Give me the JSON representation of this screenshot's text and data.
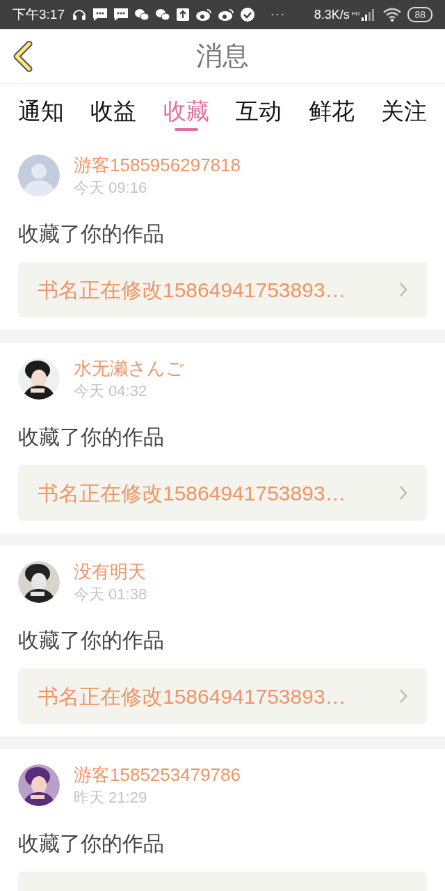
{
  "status_bar": {
    "time": "下午3:17",
    "more": "···",
    "speed": "8.3K/s",
    "network": "HD",
    "battery": "88"
  },
  "header": {
    "back": true,
    "title": "消息"
  },
  "tabs": [
    {
      "label": "通知",
      "selected": false
    },
    {
      "label": "收益",
      "selected": false
    },
    {
      "label": "收藏",
      "selected": true
    },
    {
      "label": "互动",
      "selected": false
    },
    {
      "label": "鲜花",
      "selected": false
    },
    {
      "label": "关注",
      "selected": false
    }
  ],
  "messages": [
    {
      "avatar": {
        "kind": "default"
      },
      "user": "游客1585956297818",
      "time": "今天 09:16",
      "text": "收藏了你的作品",
      "book": "书名正在修改15864941753893…"
    },
    {
      "user": "水无濑さんご",
      "time": "今天 04:32",
      "text": "收藏了你的作品",
      "book": "书名正在修改15864941753893…"
    },
    {
      "user": "没有明天",
      "time": "今天 01:38",
      "text": "收藏了你的作品",
      "book": "书名正在修改15864941753893…"
    },
    {
      "user": "游客1585253479786",
      "time": "昨天 21:29",
      "text": "收藏了你的作品"
    }
  ]
}
